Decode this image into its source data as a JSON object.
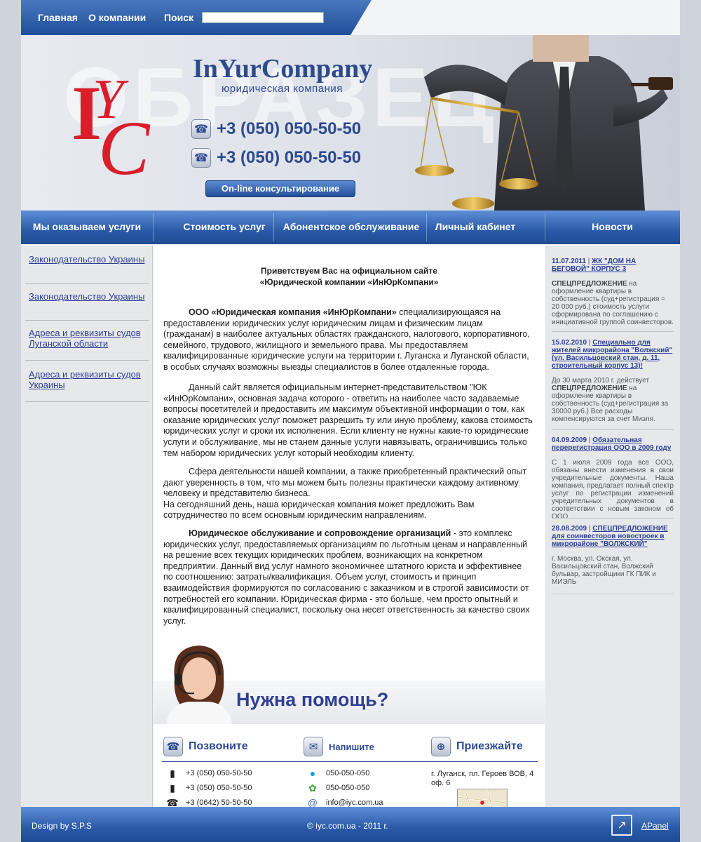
{
  "topnav": {
    "home": "Главная",
    "about": "О компании",
    "search_label": "Поиск",
    "search_value": ""
  },
  "header": {
    "brand": "InYurCompany",
    "brand_sub": "юридическая компания",
    "phone1": "+3 (050) 050-50-50",
    "phone2": "+3 (050) 050-50-50",
    "consult_button": "On-line консультирование",
    "watermark": "ОБРАЗЕЦ"
  },
  "mainmenu": {
    "services": "Мы оказываем услуги",
    "cost": "Стоимость услуг",
    "subscription": "Абонентское обслуживание",
    "cabinet": "Личный кабинет",
    "news": "Новости"
  },
  "sidebar": {
    "links": [
      "Законодательство Украины",
      "Законодательство Украины",
      "Адреса и реквизиты судов Луганской области",
      "Адреса и реквизиты судов Украины"
    ]
  },
  "content": {
    "welcome_line1": "Приветствуем Вас на официальном сайте",
    "welcome_line2": "«Юридической компании «ИнЮрКомпани»",
    "p1_bold": "ООО «Юридическая компания «ИнЮрКомпани»",
    "p1_rest": " специализирующаяся на предоставлении юридических услуг юридическим лицам и физическим лицам (гражданам) в наиболее актуальных областях гражданского, налогового, корпоративного, семейного, трудового, жилищного и земельного права. Мы предоставляем квалифицированные юридические услуги на территории г. Луганска и Луганской области, в особых случаях возможны выезды специалистов в более отдаленные города.",
    "p2": "Данный сайт является официальным интернет-представительством \"ЮК «ИнЮрКомпани», основная задача которого - ответить на наиболее часто задаваемые вопросы посетителей и предоставить им максимум объективной информации о том, как оказание юридических услуг поможет разрешить ту или иную проблему, какова стоимость юридических услуг и сроки их исполнения.  Если клиенту не нужны какие-то юридические услуги и обслуживание, мы не станем данные услуги навязывать, ограничившись только тем набором юридических услуг который необходим клиенту.",
    "p3": "Сфера деятельности нашей компании, а также приобретенный практический опыт дают уверенность в том, что мы можем быть полезны практически каждому активному человеку и представителю бизнеса.",
    "p3b": "На сегодняшний день, наша юридическая компания может предложить Вам сотрудничество по всем основным юридическим направлениям.",
    "p4_bold": "Юридическое обслуживание и сопровождение организаций",
    "p4_rest": "  - это комплекс юридических услуг, предоставляемых организациям по льготным ценам и направленный на решение всех текущих юридических проблем, возникающих на конкретном предприятии.  Данный вид услуг намного экономичнее штатного юриста и эффективнее по соотношению: затраты/квалификация. Объем услуг, стоимость и принцип взаимодействия формируются по согласованию с заказчиком и в строгой зависимости от потребностей его компании. Юридическая фирма - это больше, чем просто опытный и квалифицированный специалист, поскольку она несет ответственность за качество своих услуг."
  },
  "help": {
    "title": "Нужна помощь?",
    "call_title": "Позвоните",
    "write_title": "Напишите",
    "visit_title": "Приезжайте",
    "phones": [
      "+3 (050) 050-50-50",
      "+3 (050) 050-50-50",
      "+3 (0642) 50-50-50"
    ],
    "skype": "050-050-050",
    "icq": "050-050-050",
    "email": "info@iyc.com.ua",
    "address": "г. Луганск, пл. Героев ВОВ, 4 оф. 6"
  },
  "news": [
    {
      "date": "11.07.2011",
      "title": "ЖК \"ДОМ НА БЕГОВОЙ\" КОРПУС 3",
      "text_bold": "СПЕЦПРЕДЛОЖЕНИЕ",
      "text": " на оформление квартиры в собственность (суд+регистрация = 20 000 руб.) стоимость услуги сформирована по соглашению с инициативной группой соинвесторов."
    },
    {
      "date": "15.02.2010",
      "title": "Специально для жителей микрорайона \"Волжский\" (ул. Васильцовский стан, д. 11, строительный корпус 13)!",
      "text_pre": "До 30 марта 2010 г. действует ",
      "text_bold": "СПЕЦПРЕДЛОЖЕНИЕ",
      "text": " на оформление квартиры в собственность (суд+регистрация за 30000 руб.) Все расходы компенсируются за счет Миэля."
    },
    {
      "date": "04.09.2009",
      "title": "Обязательная перерегистрация ООО в 2009 году",
      "text": "С 1 июля 2009 года все ООО, обязаны внести изменения в свои учредительные документы. Наша компания, предлагает полный спектр услуг по регистрации изменений учредительных документов в соответствии с новым законом об ООО"
    },
    {
      "date": "28.08.2009",
      "title": "СПЕЦПРЕДЛОЖЕНИЕ для соинвесторов новостроек в микрорайоне \"ВОЛЖСКИЙ\"",
      "text": "г. Москва, ул. Окская, ул. Васильцовский стан, Волжский бульвар, застройщики ГК ПИК и МИЭЛЬ"
    }
  ],
  "footer": {
    "design": "Design by S.P.S",
    "copyright": "© iyc.com.ua - 2011 г.",
    "apanel": "APanel"
  }
}
